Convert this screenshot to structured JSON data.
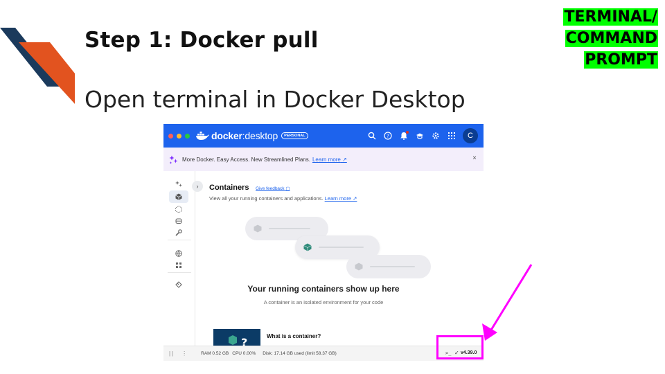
{
  "slide": {
    "title": "Step 1: Docker pull",
    "subtitle": "Open terminal in Docker Desktop",
    "tag_lines": [
      "TERMINAL/",
      "COMMAND",
      "PROMPT"
    ]
  },
  "docker_desktop": {
    "brand_bold": "docker",
    "brand_light": "desktop",
    "plan_badge": "PERSONAL",
    "avatar_initial": "C",
    "banner": {
      "message": "More Docker. Easy Access. New Streamlined Plans.",
      "link": "Learn more",
      "close": "×"
    },
    "page": {
      "title": "Containers",
      "feedback_link": "Give feedback",
      "description": "View all your running containers and applications.",
      "description_link": "Learn more"
    },
    "empty_state": {
      "title": "Your running containers show up here",
      "description": "A container is an isolated environment for your code"
    },
    "card": {
      "title": "What is a container?",
      "thumb_glyph": "?"
    },
    "status_bar": {
      "ram": "RAM 0.52 GB",
      "cpu": "CPU 0.00%",
      "disk": "Disk: 17.14 GB used (limit 58.37 GB)",
      "terminal_glyph": ">_",
      "check_glyph": "✓",
      "version": "v4.39.0"
    }
  },
  "colors": {
    "docker_blue": "#1d63ed",
    "highlight": "#ff00ff",
    "tag_bg": "#00ff00",
    "deco_navy": "#1b3a5c",
    "deco_orange": "#e2531f"
  }
}
